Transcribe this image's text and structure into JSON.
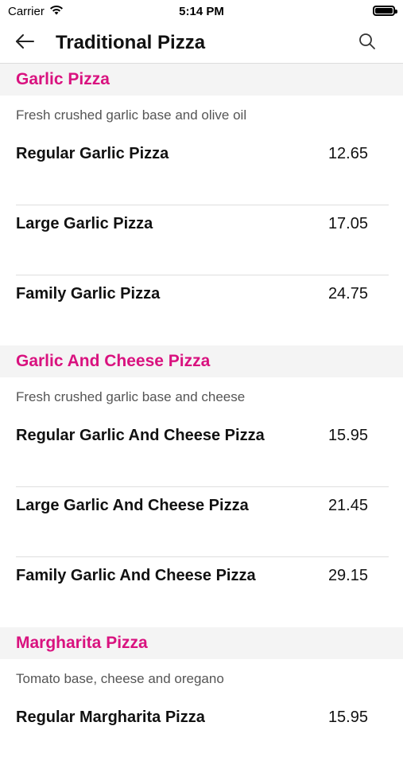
{
  "status_bar": {
    "carrier": "Carrier",
    "time": "5:14 PM"
  },
  "nav": {
    "title": "Traditional Pizza",
    "back_icon": "arrow-left-icon",
    "search_icon": "search-icon"
  },
  "colors": {
    "section_title": "#d9127f",
    "section_bg": "#f4f4f4",
    "divider": "#dedede"
  },
  "sections": [
    {
      "title": "Garlic Pizza",
      "description": "Fresh crushed garlic base and olive oil",
      "items": [
        {
          "name": "Regular Garlic Pizza",
          "price": "12.65"
        },
        {
          "name": "Large Garlic Pizza",
          "price": "17.05"
        },
        {
          "name": "Family Garlic Pizza",
          "price": "24.75"
        }
      ]
    },
    {
      "title": "Garlic And Cheese Pizza",
      "description": "Fresh crushed garlic base and cheese",
      "items": [
        {
          "name": "Regular Garlic And Cheese Pizza",
          "price": "15.95"
        },
        {
          "name": "Large Garlic And Cheese Pizza",
          "price": "21.45"
        },
        {
          "name": "Family Garlic And Cheese Pizza",
          "price": "29.15"
        }
      ]
    },
    {
      "title": "Margharita Pizza",
      "description": "Tomato base, cheese and oregano",
      "items": [
        {
          "name": "Regular Margharita Pizza",
          "price": "15.95"
        }
      ]
    }
  ]
}
